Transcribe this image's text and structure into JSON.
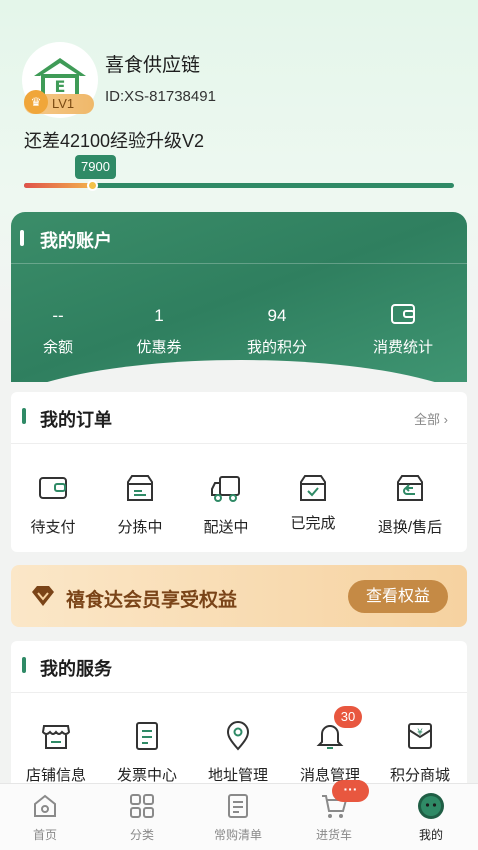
{
  "profile": {
    "shop_name": "喜食供应链",
    "shop_id": "ID:XS-81738491",
    "level": "LV1",
    "exp_text": "还差42100经验升级V2",
    "exp_value": "7900",
    "progress_fraction": 0.16
  },
  "account": {
    "title": "我的账户",
    "items": [
      {
        "value": "--",
        "label": "余额"
      },
      {
        "value": "1",
        "label": "优惠券"
      },
      {
        "value": "94",
        "label": "我的积分"
      },
      {
        "icon": "wallet-icon",
        "label": "消费统计"
      }
    ]
  },
  "orders": {
    "title": "我的订单",
    "more": "全部",
    "items": [
      {
        "icon": "wallet-icon",
        "label": "待支付"
      },
      {
        "icon": "box-icon",
        "label": "分拣中"
      },
      {
        "icon": "truck-icon",
        "label": "配送中"
      },
      {
        "icon": "box-check-icon",
        "label": "已完成"
      },
      {
        "icon": "return-box-icon",
        "label": "退换/售后"
      }
    ]
  },
  "vip": {
    "text": "禧食达会员享受权益",
    "button": "查看权益"
  },
  "services": {
    "title": "我的服务",
    "items": [
      {
        "icon": "store-icon",
        "label": "店铺信息"
      },
      {
        "icon": "invoice-icon",
        "label": "发票中心"
      },
      {
        "icon": "location-icon",
        "label": "地址管理"
      },
      {
        "icon": "bell-icon",
        "label": "消息管理",
        "badge": "30"
      },
      {
        "icon": "points-mall-icon",
        "label": "积分商城"
      }
    ]
  },
  "tabbar": {
    "items": [
      {
        "icon": "home-icon",
        "label": "首页"
      },
      {
        "icon": "category-icon",
        "label": "分类"
      },
      {
        "icon": "list-icon",
        "label": "常购清单"
      },
      {
        "icon": "cart-icon",
        "label": "进货车",
        "badge": "···"
      },
      {
        "icon": "profile-icon",
        "label": "我的",
        "active": true
      }
    ]
  },
  "colors": {
    "brand_green": "#2f8a66",
    "vip_gold": "#c58a45",
    "badge_red": "#e8573f"
  }
}
